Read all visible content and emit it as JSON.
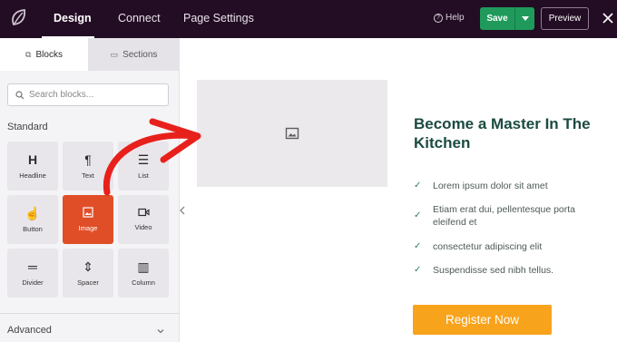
{
  "topbar": {
    "tabs": [
      {
        "label": "Design",
        "active": true
      },
      {
        "label": "Connect",
        "active": false
      },
      {
        "label": "Page Settings",
        "active": false
      }
    ],
    "help_label": "Help",
    "save_label": "Save",
    "preview_label": "Preview"
  },
  "sidebar": {
    "tabs": [
      {
        "label": "Blocks",
        "icon": "blocks-icon"
      },
      {
        "label": "Sections",
        "icon": "sections-icon"
      }
    ],
    "search_placeholder": "Search blocks...",
    "standard_heading": "Standard",
    "blocks": [
      {
        "label": "Headline",
        "icon": "H"
      },
      {
        "label": "Text",
        "icon": "¶"
      },
      {
        "label": "List",
        "icon": "☰"
      },
      {
        "label": "Button",
        "icon": "☝"
      },
      {
        "label": "Image",
        "icon": "▣",
        "active": true
      },
      {
        "label": "Video",
        "icon": "▶"
      },
      {
        "label": "Divider",
        "icon": "═"
      },
      {
        "label": "Spacer",
        "icon": "⇕"
      },
      {
        "label": "Column",
        "icon": "▥"
      }
    ],
    "advanced_heading": "Advanced"
  },
  "canvas": {
    "headline": "Become a Master In The Kitchen",
    "checklist": [
      "Lorem ipsum dolor sit amet",
      "Etiam erat dui, pellentesque porta eleifend et",
      "consectetur adipiscing elit",
      "Suspendisse sed nibh tellus."
    ],
    "cta_label": "Register Now"
  },
  "colors": {
    "topbar_bg": "#230d24",
    "save_green": "#1f9a5b",
    "active_block": "#e04e27",
    "headline": "#1b4a40",
    "cta_orange": "#f8a31c",
    "annotation_arrow": "#e8201c"
  }
}
